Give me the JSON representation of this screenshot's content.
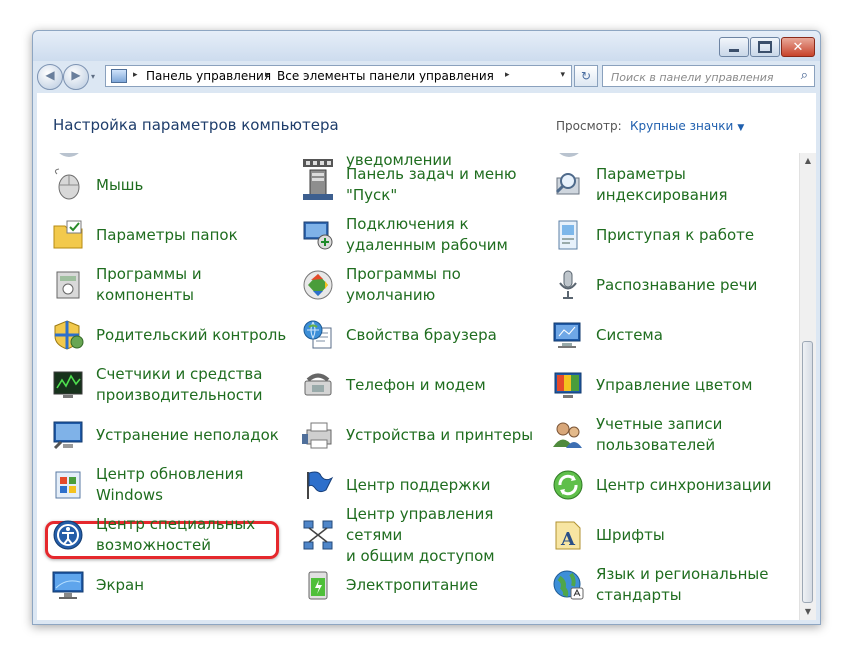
{
  "window": {
    "controls": {
      "minimize_icon": "minimize-icon",
      "maximize_icon": "maximize-icon",
      "close_icon": "close-icon",
      "close_glyph": "✕"
    }
  },
  "nav": {
    "back_glyph": "◀",
    "forward_glyph": "▶",
    "breadcrumb": [
      "Панель управления",
      "Все элементы панели управления"
    ],
    "arrow_glyph": "▸",
    "dropdown_glyph": "▾",
    "refresh_glyph": "↻",
    "search_placeholder": "Поиск в панели управления",
    "search_glyph": "⌕"
  },
  "header": {
    "title": "Настройка параметров компьютера",
    "view_label": "Просмотр:",
    "view_value": "Крупные значки",
    "view_caret": "▼"
  },
  "scrollbar": {
    "up_glyph": "▲",
    "down_glyph": "▼"
  },
  "items": [
    {
      "col": 0,
      "row": 0,
      "lines": [
        "Мышь"
      ],
      "icon": "mouse-icon"
    },
    {
      "col": 1,
      "row": 0,
      "lines": [
        "Панель задач и меню",
        "\"Пуск\""
      ],
      "icon": "taskbar-icon"
    },
    {
      "col": 2,
      "row": 0,
      "lines": [
        "Параметры",
        "индексирования"
      ],
      "icon": "indexing-icon"
    },
    {
      "col": 0,
      "row": 1,
      "lines": [
        "Параметры папок"
      ],
      "icon": "folder-options-icon"
    },
    {
      "col": 1,
      "row": 1,
      "lines": [
        "Подключения к",
        "удаленным рабочим"
      ],
      "icon": "remote-desktop-icon"
    },
    {
      "col": 2,
      "row": 1,
      "lines": [
        "Приступая к работе"
      ],
      "icon": "getting-started-icon"
    },
    {
      "col": 0,
      "row": 2,
      "lines": [
        "Программы и",
        "компоненты"
      ],
      "icon": "programs-icon"
    },
    {
      "col": 1,
      "row": 2,
      "lines": [
        "Программы по",
        "умолчанию"
      ],
      "icon": "default-programs-icon"
    },
    {
      "col": 2,
      "row": 2,
      "lines": [
        "Распознавание речи"
      ],
      "icon": "microphone-icon"
    },
    {
      "col": 0,
      "row": 3,
      "lines": [
        "Родительский контроль"
      ],
      "icon": "parental-control-icon"
    },
    {
      "col": 1,
      "row": 3,
      "lines": [
        "Свойства браузера"
      ],
      "icon": "internet-options-icon"
    },
    {
      "col": 2,
      "row": 3,
      "lines": [
        "Система"
      ],
      "icon": "system-icon"
    },
    {
      "col": 0,
      "row": 4,
      "lines": [
        "Счетчики и средства",
        "производительности"
      ],
      "icon": "performance-icon"
    },
    {
      "col": 1,
      "row": 4,
      "lines": [
        "Телефон и модем"
      ],
      "icon": "phone-modem-icon"
    },
    {
      "col": 2,
      "row": 4,
      "lines": [
        "Управление цветом"
      ],
      "icon": "color-management-icon"
    },
    {
      "col": 0,
      "row": 5,
      "lines": [
        "Устранение неполадок"
      ],
      "icon": "troubleshooting-icon"
    },
    {
      "col": 1,
      "row": 5,
      "lines": [
        "Устройства и принтеры"
      ],
      "icon": "devices-printers-icon"
    },
    {
      "col": 2,
      "row": 5,
      "lines": [
        "Учетные записи",
        "пользователей"
      ],
      "icon": "user-accounts-icon"
    },
    {
      "col": 0,
      "row": 6,
      "lines": [
        "Центр обновления",
        "Windows"
      ],
      "icon": "windows-update-icon"
    },
    {
      "col": 1,
      "row": 6,
      "lines": [
        "Центр поддержки"
      ],
      "icon": "action-center-flag-icon"
    },
    {
      "col": 2,
      "row": 6,
      "lines": [
        "Центр синхронизации"
      ],
      "icon": "sync-center-icon"
    },
    {
      "col": 0,
      "row": 7,
      "lines": [
        "Центр специальных",
        "возможностей"
      ],
      "icon": "ease-of-access-icon"
    },
    {
      "col": 1,
      "row": 7,
      "lines": [
        "Центр управления сетями",
        "и общим доступом"
      ],
      "icon": "network-center-icon"
    },
    {
      "col": 2,
      "row": 7,
      "lines": [
        "Шрифты"
      ],
      "icon": "fonts-icon"
    },
    {
      "col": 0,
      "row": 8,
      "lines": [
        "Экран"
      ],
      "icon": "display-icon"
    },
    {
      "col": 1,
      "row": 8,
      "lines": [
        "Электропитание"
      ],
      "icon": "power-options-icon"
    },
    {
      "col": 2,
      "row": 8,
      "lines": [
        "Язык и региональные",
        "стандарты"
      ],
      "icon": "region-language-icon"
    }
  ],
  "partial_top": {
    "lines": [
      "уведомлении"
    ],
    "icon": "notification-icons-icon"
  }
}
